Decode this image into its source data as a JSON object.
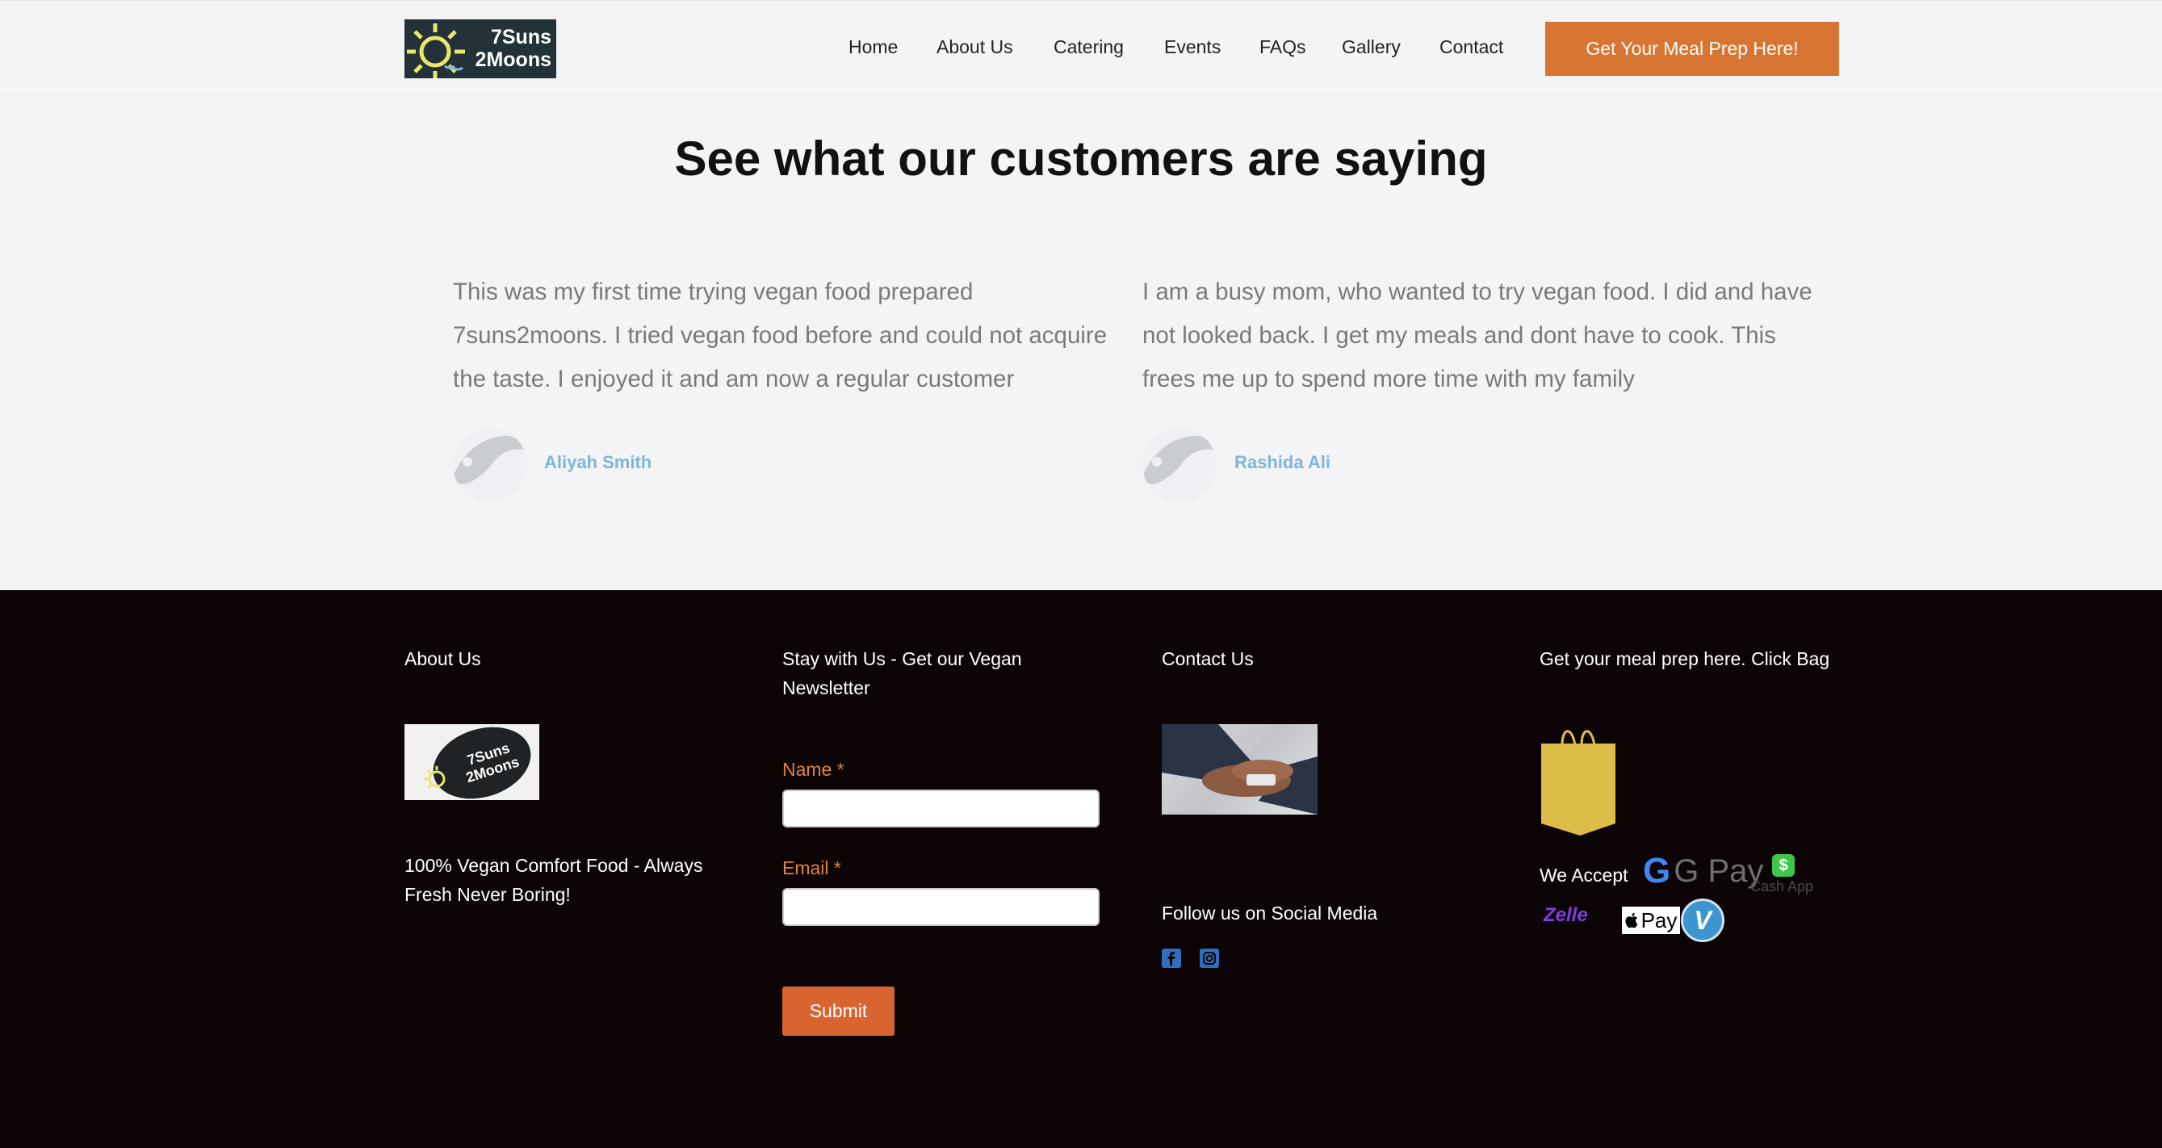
{
  "header": {
    "logo_line1": "7Suns",
    "logo_line2": "2Moons",
    "nav": [
      "Home",
      "About Us",
      "Catering",
      "Events",
      "FAQs",
      "Gallery",
      "Contact"
    ],
    "cta": "Get Your Meal Prep Here!"
  },
  "testimonials": {
    "title": "See what our customers are saying",
    "items": [
      {
        "quote": "This was my first time trying vegan food prepared 7suns2moons. I tried vegan food before and could not acquire the taste. I enjoyed it and am now a regular customer",
        "name": "Aliyah Smith"
      },
      {
        "quote": "I am a busy mom, who wanted to try vegan food. I did and have not looked back. I get my meals and dont have to cook. This frees me up to spend more time with my family",
        "name": "Rashida Ali"
      }
    ]
  },
  "footer": {
    "about": {
      "heading": "About Us",
      "tagline": "100% Vegan Comfort Food - Always Fresh Never Boring!"
    },
    "newsletter": {
      "heading": "Stay with Us - Get our Vegan Newsletter",
      "name_label": "Name",
      "email_label": "Email",
      "required_mark": "*",
      "submit": "Submit"
    },
    "contact": {
      "heading": "Contact Us",
      "social_heading": "Follow us on Social Media",
      "icons": [
        "facebook-icon",
        "instagram-icon"
      ]
    },
    "shop": {
      "heading": "Get your meal prep here. Click Bag",
      "we_accept": "We Accept",
      "payments": [
        "G Pay",
        "Cash App",
        "Zelle",
        "Pay",
        "V"
      ]
    }
  },
  "colors": {
    "accent": "#d97532",
    "footer_bg": "#0d0505",
    "author": "#7eb6d9"
  }
}
